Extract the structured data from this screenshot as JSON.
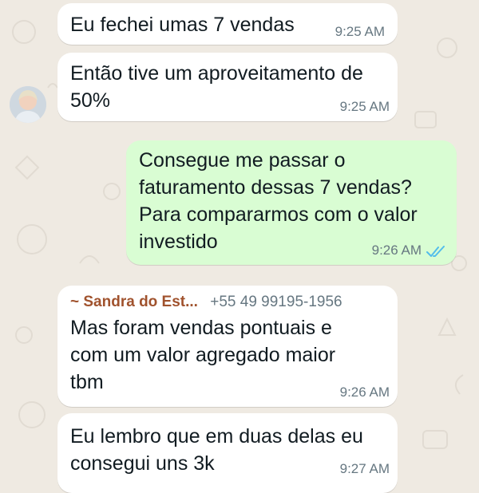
{
  "messages": [
    {
      "text": "Eu fechei umas 7 vendas",
      "time": "9:25 AM"
    },
    {
      "text": "Então tive um aproveitamento de\n50%",
      "time": "9:25 AM"
    },
    {
      "text": "Consegue me passar o\nfaturamento dessas 7 vendas?\nPara compararmos com o valor\ninvestido",
      "time": "9:26 AM",
      "status_icon": "double-check-read-icon"
    },
    {
      "sender_name": "~ Sandra do Est...",
      "sender_phone": "+55 49 99195-1956",
      "text": "Mas foram vendas pontuais e\ncom um valor agregado maior\ntbm",
      "time": "9:26 AM"
    },
    {
      "text": "Eu lembro que em duas delas eu\nconsegui uns 3k",
      "time": "9:27 AM"
    }
  ],
  "colors": {
    "chat_background": "#efeae2",
    "incoming_bubble": "#ffffff",
    "outgoing_bubble": "#d9fdd3",
    "read_receipt": "#53bdeb",
    "sender_name": "#a0522d"
  }
}
